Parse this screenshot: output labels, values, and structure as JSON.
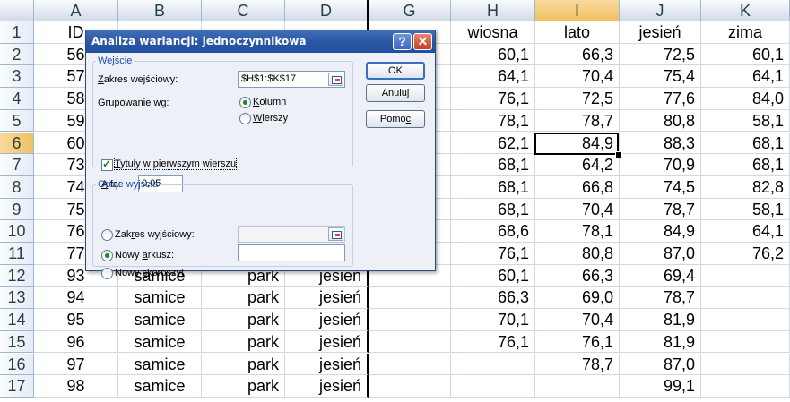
{
  "sheet": {
    "columns": [
      "A",
      "B",
      "C",
      "D",
      "G",
      "H",
      "I",
      "J",
      "K"
    ],
    "selected_column": "I",
    "selected_row": "6",
    "rows": [
      {
        "n": "1",
        "A": "ID",
        "B": "",
        "C": "",
        "D": "",
        "G": "",
        "H": "wiosna",
        "I": "lato",
        "J": "jesień",
        "K": "zima"
      },
      {
        "n": "2",
        "A": "56",
        "B": "",
        "C": "",
        "D": "",
        "G": "",
        "H": "60,1",
        "I": "66,3",
        "J": "72,5",
        "K": "60,1"
      },
      {
        "n": "3",
        "A": "57",
        "B": "",
        "C": "",
        "D": "",
        "G": "",
        "H": "64,1",
        "I": "70,4",
        "J": "75,4",
        "K": "64,1"
      },
      {
        "n": "4",
        "A": "58",
        "B": "",
        "C": "",
        "D": "",
        "G": "",
        "H": "76,1",
        "I": "72,5",
        "J": "77,6",
        "K": "84,0"
      },
      {
        "n": "5",
        "A": "59",
        "B": "",
        "C": "",
        "D": "",
        "G": "",
        "H": "78,1",
        "I": "78,7",
        "J": "80,8",
        "K": "58,1"
      },
      {
        "n": "6",
        "A": "60",
        "B": "",
        "C": "",
        "D": "",
        "G": "",
        "H": "62,1",
        "I": "84,9",
        "J": "88,3",
        "K": "68,1"
      },
      {
        "n": "7",
        "A": "73",
        "B": "",
        "C": "",
        "D": "",
        "G": "",
        "H": "68,1",
        "I": "64,2",
        "J": "70,9",
        "K": "68,1"
      },
      {
        "n": "8",
        "A": "74",
        "B": "",
        "C": "",
        "D": "",
        "G": "",
        "H": "68,1",
        "I": "66,8",
        "J": "74,5",
        "K": "82,8"
      },
      {
        "n": "9",
        "A": "75",
        "B": "",
        "C": "",
        "D": "",
        "G": "",
        "H": "68,1",
        "I": "70,4",
        "J": "78,7",
        "K": "58,1"
      },
      {
        "n": "10",
        "A": "76",
        "B": "",
        "C": "",
        "D": "",
        "G": "",
        "H": "68,6",
        "I": "78,1",
        "J": "84,9",
        "K": "64,1"
      },
      {
        "n": "11",
        "A": "77",
        "B": "",
        "C": "",
        "D": "",
        "G": "",
        "H": "76,1",
        "I": "80,8",
        "J": "87,0",
        "K": "76,2"
      },
      {
        "n": "12",
        "A": "93",
        "B": "samice",
        "C": "park",
        "D": "jesień",
        "G": "",
        "H": "60,1",
        "I": "66,3",
        "J": "69,4",
        "K": ""
      },
      {
        "n": "13",
        "A": "94",
        "B": "samice",
        "C": "park",
        "D": "jesień",
        "G": "",
        "H": "66,3",
        "I": "69,0",
        "J": "78,7",
        "K": ""
      },
      {
        "n": "14",
        "A": "95",
        "B": "samice",
        "C": "park",
        "D": "jesień",
        "G": "",
        "H": "70,1",
        "I": "70,4",
        "J": "81,9",
        "K": ""
      },
      {
        "n": "15",
        "A": "96",
        "B": "samice",
        "C": "park",
        "D": "jesień",
        "G": "",
        "H": "76,1",
        "I": "76,1",
        "J": "81,9",
        "K": ""
      },
      {
        "n": "16",
        "A": "97",
        "B": "samice",
        "C": "park",
        "D": "jesień",
        "G": "",
        "H": "",
        "I": "78,7",
        "J": "87,0",
        "K": ""
      },
      {
        "n": "17",
        "A": "98",
        "B": "samice",
        "C": "park",
        "D": "jesień",
        "G": "",
        "H": "",
        "I": "",
        "J": "99,1",
        "K": ""
      }
    ]
  },
  "dialog": {
    "title": "Analiza wariancji: jednoczynnikowa",
    "help_glyph": "?",
    "close_glyph": "✕",
    "input_group": "Wejście",
    "input_range_label_u": "Z",
    "input_range_label_rest": "akres wejściowy:",
    "input_range_value": "$H$1:$K$17",
    "grouping_label": "Grupowanie wg:",
    "columns_u": "K",
    "columns_rest": "olumn",
    "rows_u": "W",
    "rows_rest": "ierszy",
    "labels_first_row_u": "T",
    "labels_first_row_rest": "ytuły w pierwszym wierszu",
    "alpha_u": "A",
    "alpha_rest": "lfa:",
    "alpha_value": "0,05",
    "output_group": "Opcje wyjścia",
    "output_range_pre": "Zak",
    "output_range_u": "r",
    "output_range_post": "es wyjściowy:",
    "new_sheet_pre": "Nowy ",
    "new_sheet_u": "a",
    "new_sheet_post": "rkusz:",
    "new_workbook_pre": "Nowy ",
    "new_workbook_u": "s",
    "new_workbook_post": "koroszyt",
    "ok": "OK",
    "cancel": "Anuluj",
    "help_pre": "Pomo",
    "help_u": "c",
    "columns_selected": true,
    "labels_checked": true,
    "new_sheet_selected": true
  }
}
